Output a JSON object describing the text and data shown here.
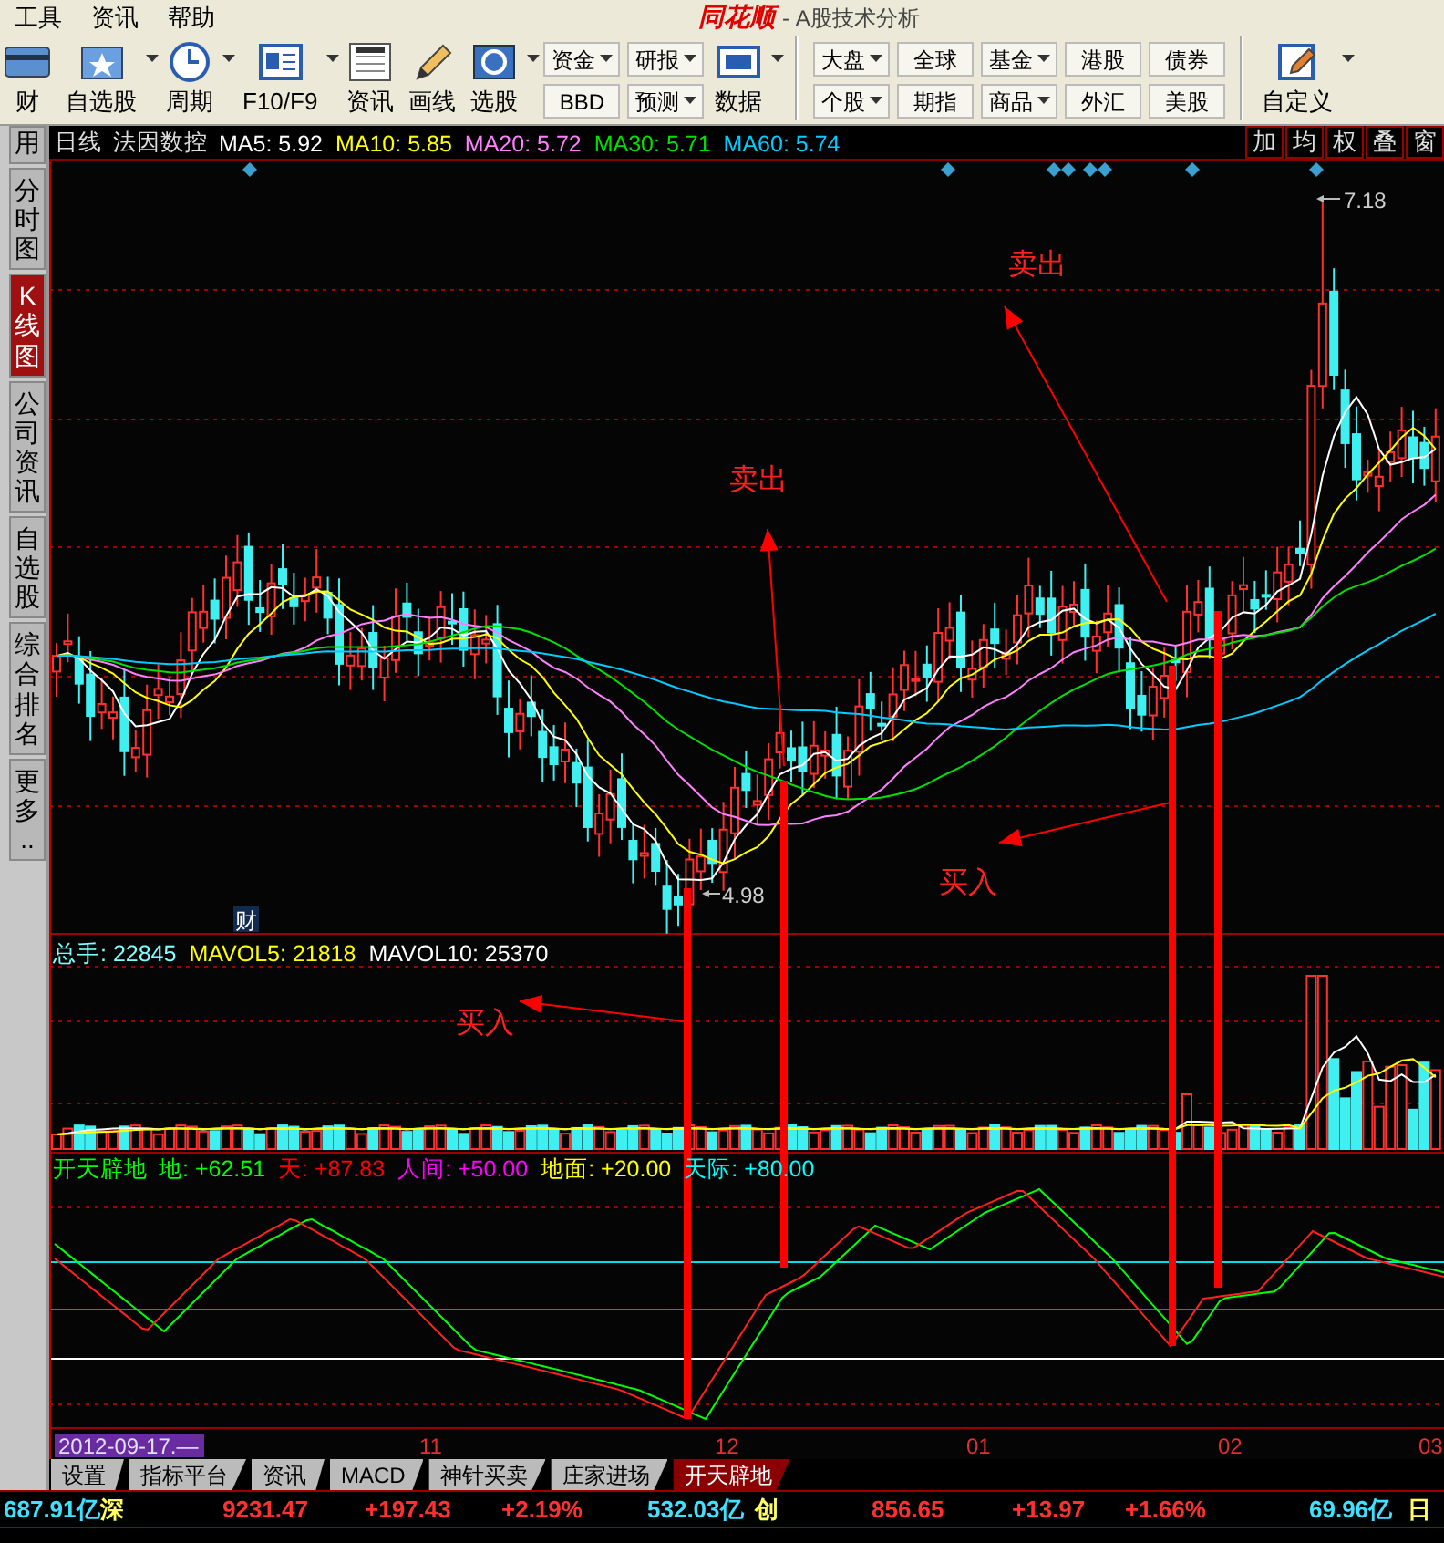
{
  "menu": [
    "工具",
    "资讯",
    "帮助"
  ],
  "app_title": {
    "brand": "同花顺",
    "subtitle": "- A股技术分析"
  },
  "toolbar": [
    {
      "kind": "large",
      "label": "财",
      "dropdown": false
    },
    {
      "kind": "large",
      "label": "自选股",
      "dropdown": true
    },
    {
      "kind": "large",
      "label": "周期",
      "dropdown": true
    },
    {
      "kind": "large",
      "label": "F10/F9",
      "dropdown": true
    },
    {
      "kind": "large",
      "label": "资讯",
      "dropdown": false
    },
    {
      "kind": "large",
      "label": "画线",
      "dropdown": false
    },
    {
      "kind": "large",
      "label": "选股",
      "dropdown": true
    },
    {
      "kind": "pair",
      "top": {
        "label": "资金",
        "dropdown": true
      },
      "bottom": {
        "label": "BBD",
        "dropdown": false
      }
    },
    {
      "kind": "pair",
      "top": {
        "label": "研报",
        "dropdown": true
      },
      "bottom": {
        "label": "预测",
        "dropdown": true
      }
    },
    {
      "kind": "large",
      "label": "数据",
      "dropdown": true
    },
    {
      "kind": "separator"
    },
    {
      "kind": "pair",
      "top": {
        "label": "大盘",
        "dropdown": true
      },
      "bottom": {
        "label": "个股",
        "dropdown": true
      }
    },
    {
      "kind": "pair",
      "top": {
        "label": "全球",
        "dropdown": false
      },
      "bottom": {
        "label": "期指",
        "dropdown": false
      }
    },
    {
      "kind": "pair",
      "top": {
        "label": "基金",
        "dropdown": true
      },
      "bottom": {
        "label": "商品",
        "dropdown": true
      }
    },
    {
      "kind": "pair",
      "top": {
        "label": "港股",
        "dropdown": false
      },
      "bottom": {
        "label": "外汇",
        "dropdown": false
      }
    },
    {
      "kind": "pair",
      "top": {
        "label": "债券",
        "dropdown": false
      },
      "bottom": {
        "label": "美股",
        "dropdown": false
      }
    },
    {
      "kind": "separator"
    },
    {
      "kind": "large",
      "label": "自定义",
      "dropdown": true
    }
  ],
  "chart_header": {
    "period": "日线",
    "stock": "法因数控",
    "ma": [
      {
        "label": "MA5: 5.92",
        "color": "#ffffff"
      },
      {
        "label": "MA10: 5.85",
        "color": "#ffff00"
      },
      {
        "label": "MA20: 5.72",
        "color": "#ff80ff"
      },
      {
        "label": "MA30: 5.71",
        "color": "#00e000"
      },
      {
        "label": "MA60: 5.74",
        "color": "#00ccff"
      }
    ],
    "buttons": [
      "加",
      "均",
      "权",
      "叠",
      "窗"
    ]
  },
  "side_tabs": [
    {
      "label": "用",
      "selected": false
    },
    {
      "label": "分时图",
      "selected": false
    },
    {
      "label": "K线图",
      "selected": true
    },
    {
      "label": "公司资讯",
      "selected": false
    },
    {
      "label": "自选股",
      "selected": false
    },
    {
      "label": "综合排名",
      "selected": false
    },
    {
      "label": "更多..",
      "selected": false
    }
  ],
  "price_chart": {
    "high_label": "7.18",
    "low_label": "4.98",
    "event_tag": "财",
    "annotations": [
      {
        "text": "卖出"
      },
      {
        "text": "卖出"
      },
      {
        "text": "买入"
      }
    ]
  },
  "volume_panel": {
    "legend": [
      {
        "label": "总手: 22845",
        "color": "#80ffff"
      },
      {
        "label": "MAVOL5: 21818",
        "color": "#ffff00"
      },
      {
        "label": "MAVOL10: 25370",
        "color": "#ffffff"
      }
    ],
    "annotation": "买入"
  },
  "indicator_panel": {
    "name": "开天辟地",
    "legend": [
      {
        "label": "地: +62.51",
        "color": "#00ff00"
      },
      {
        "label": "天: +87.83",
        "color": "#ff0000"
      },
      {
        "label": "人间: +50.00",
        "color": "#ff00ff"
      },
      {
        "label": "地面: +20.00",
        "color": "#ffff00"
      },
      {
        "label": "天际: +80.00",
        "color": "#00ffff"
      }
    ]
  },
  "x_axis": {
    "start_date": "2012-09-17.—",
    "ticks": [
      "11",
      "12",
      "01",
      "02",
      "03"
    ]
  },
  "bottom_tabs": [
    {
      "label": "设置",
      "selected": false
    },
    {
      "label": "指标平台",
      "selected": false
    },
    {
      "label": "资讯",
      "selected": false
    },
    {
      "label": "MACD",
      "selected": false
    },
    {
      "label": "神针买卖",
      "selected": false
    },
    {
      "label": "庄家进场",
      "selected": false
    },
    {
      "label": "开天辟地",
      "selected": true
    }
  ],
  "status_bar": [
    {
      "text": "687.91亿",
      "kind": "amount"
    },
    {
      "text": "深",
      "kind": "market"
    },
    {
      "text": "9231.47",
      "kind": "up"
    },
    {
      "text": "+197.43",
      "kind": "up"
    },
    {
      "text": "+2.19%",
      "kind": "up"
    },
    {
      "text": "532.03亿",
      "kind": "amount"
    },
    {
      "text": "创",
      "kind": "market"
    },
    {
      "text": "856.65",
      "kind": "up"
    },
    {
      "text": "+13.97",
      "kind": "up"
    },
    {
      "text": "+1.66%",
      "kind": "up"
    },
    {
      "text": "69.96亿",
      "kind": "amount"
    },
    {
      "text": "日",
      "kind": "market"
    }
  ]
}
